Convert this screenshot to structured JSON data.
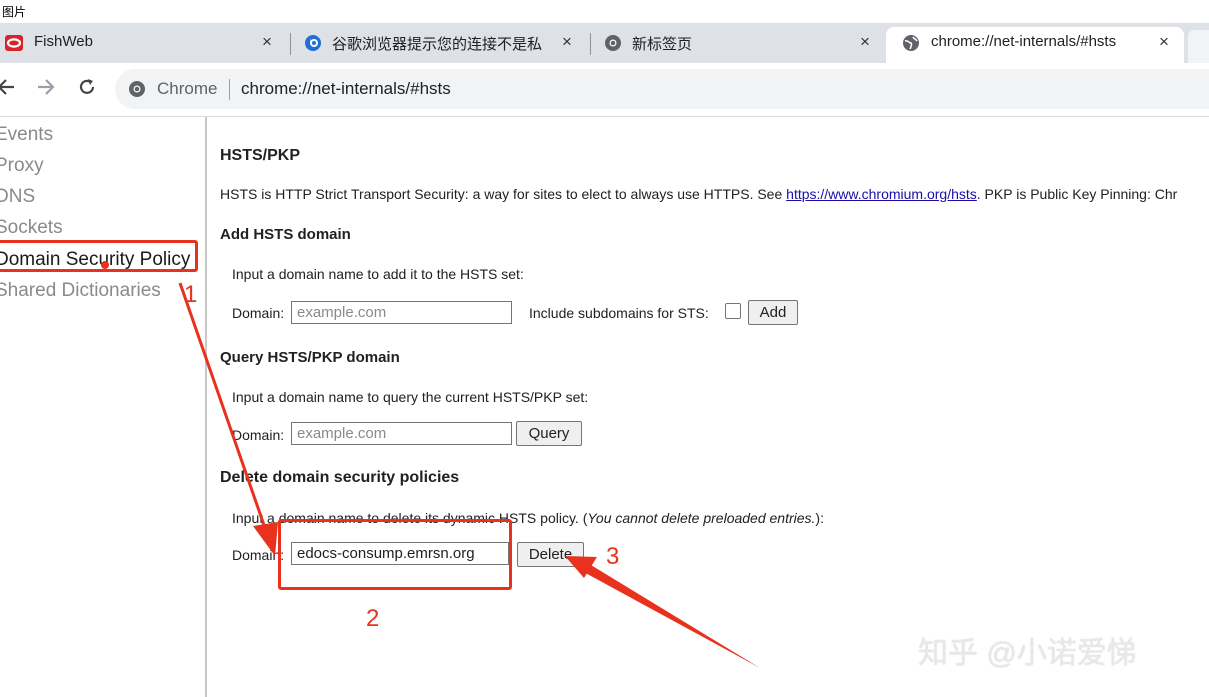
{
  "caption": "图片",
  "tabs": [
    {
      "title": "FishWeb",
      "icon": "oracle-logo-icon"
    },
    {
      "title": "谷歌浏览器提示您的连接不是私",
      "icon": "browser-logo-icon"
    },
    {
      "title": "新标签页",
      "icon": "chrome-logo-icon"
    },
    {
      "title": "chrome://net-internals/#hsts",
      "icon": "globe-icon",
      "active": true
    }
  ],
  "tab_close_glyph": "×",
  "omnibox": {
    "site_label": "Chrome",
    "url": "chrome://net-internals/#hsts"
  },
  "sidebar": {
    "items": [
      {
        "label": "Events"
      },
      {
        "label": "Proxy"
      },
      {
        "label": "DNS"
      },
      {
        "label": "Sockets"
      },
      {
        "label": "Domain Security Policy",
        "selected": true
      },
      {
        "label": "Shared Dictionaries"
      }
    ]
  },
  "main": {
    "title": "HSTS/PKP",
    "intro_prefix": "HSTS is HTTP Strict Transport Security: a way for sites to elect to always use HTTPS. See ",
    "intro_link": "https://www.chromium.org/hsts",
    "intro_suffix": ". PKP is Public Key Pinning: Chr",
    "add": {
      "heading": "Add HSTS domain",
      "help": "Input a domain name to add it to the HSTS set:",
      "domain_label": "Domain:",
      "placeholder": "example.com",
      "subdomains_label": "Include subdomains for STS:",
      "button": "Add"
    },
    "query": {
      "heading": "Query HSTS/PKP domain",
      "help": "Input a domain name to query the current HSTS/PKP set:",
      "domain_label": "Domain:",
      "placeholder": "example.com",
      "button": "Query"
    },
    "delete": {
      "heading": "Delete domain security policies",
      "help_prefix": "Input a domain name to delete its dynamic HSTS policy. (",
      "help_italic": "You cannot delete preloaded entries.",
      "help_suffix": "):",
      "domain_label": "Domain:",
      "value": "edocs-consump.emrsn.org",
      "button": "Delete"
    }
  },
  "annotations": {
    "step1": "1",
    "step2": "2",
    "step3": "3",
    "color": "#e8321e"
  },
  "watermark": "知乎 @小诺爱悌"
}
